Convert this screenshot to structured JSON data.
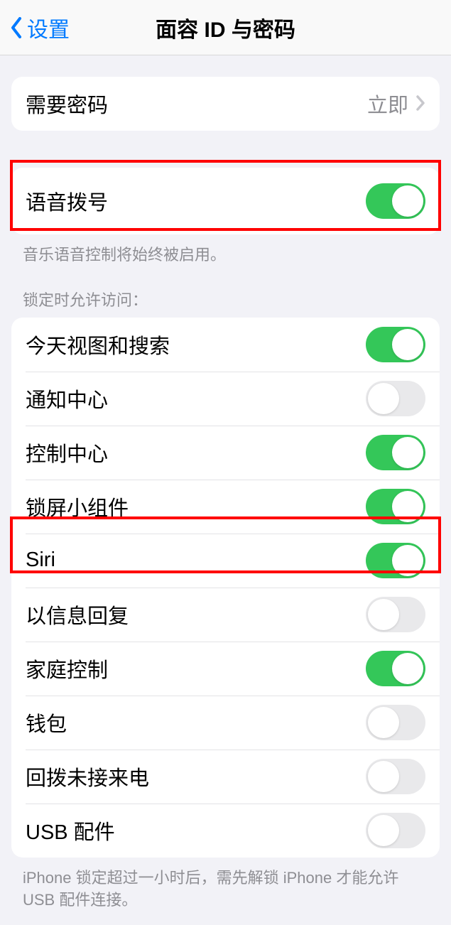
{
  "nav": {
    "back_label": "设置",
    "title": "面容 ID 与密码"
  },
  "require_passcode": {
    "label": "需要密码",
    "value": "立即"
  },
  "voice_dial": {
    "label": "语音拨号",
    "on": true,
    "footer": "音乐语音控制将始终被启用。"
  },
  "locked_access": {
    "header": "锁定时允许访问：",
    "items": [
      {
        "label": "今天视图和搜索",
        "on": true
      },
      {
        "label": "通知中心",
        "on": false
      },
      {
        "label": "控制中心",
        "on": true
      },
      {
        "label": "锁屏小组件",
        "on": true
      },
      {
        "label": "Siri",
        "on": true
      },
      {
        "label": "以信息回复",
        "on": false
      },
      {
        "label": "家庭控制",
        "on": true
      },
      {
        "label": "钱包",
        "on": false
      },
      {
        "label": "回拨未接来电",
        "on": false
      },
      {
        "label": "USB 配件",
        "on": false
      }
    ],
    "footer": "iPhone 锁定超过一小时后，需先解锁 iPhone 才能允许 USB 配件连接。"
  }
}
